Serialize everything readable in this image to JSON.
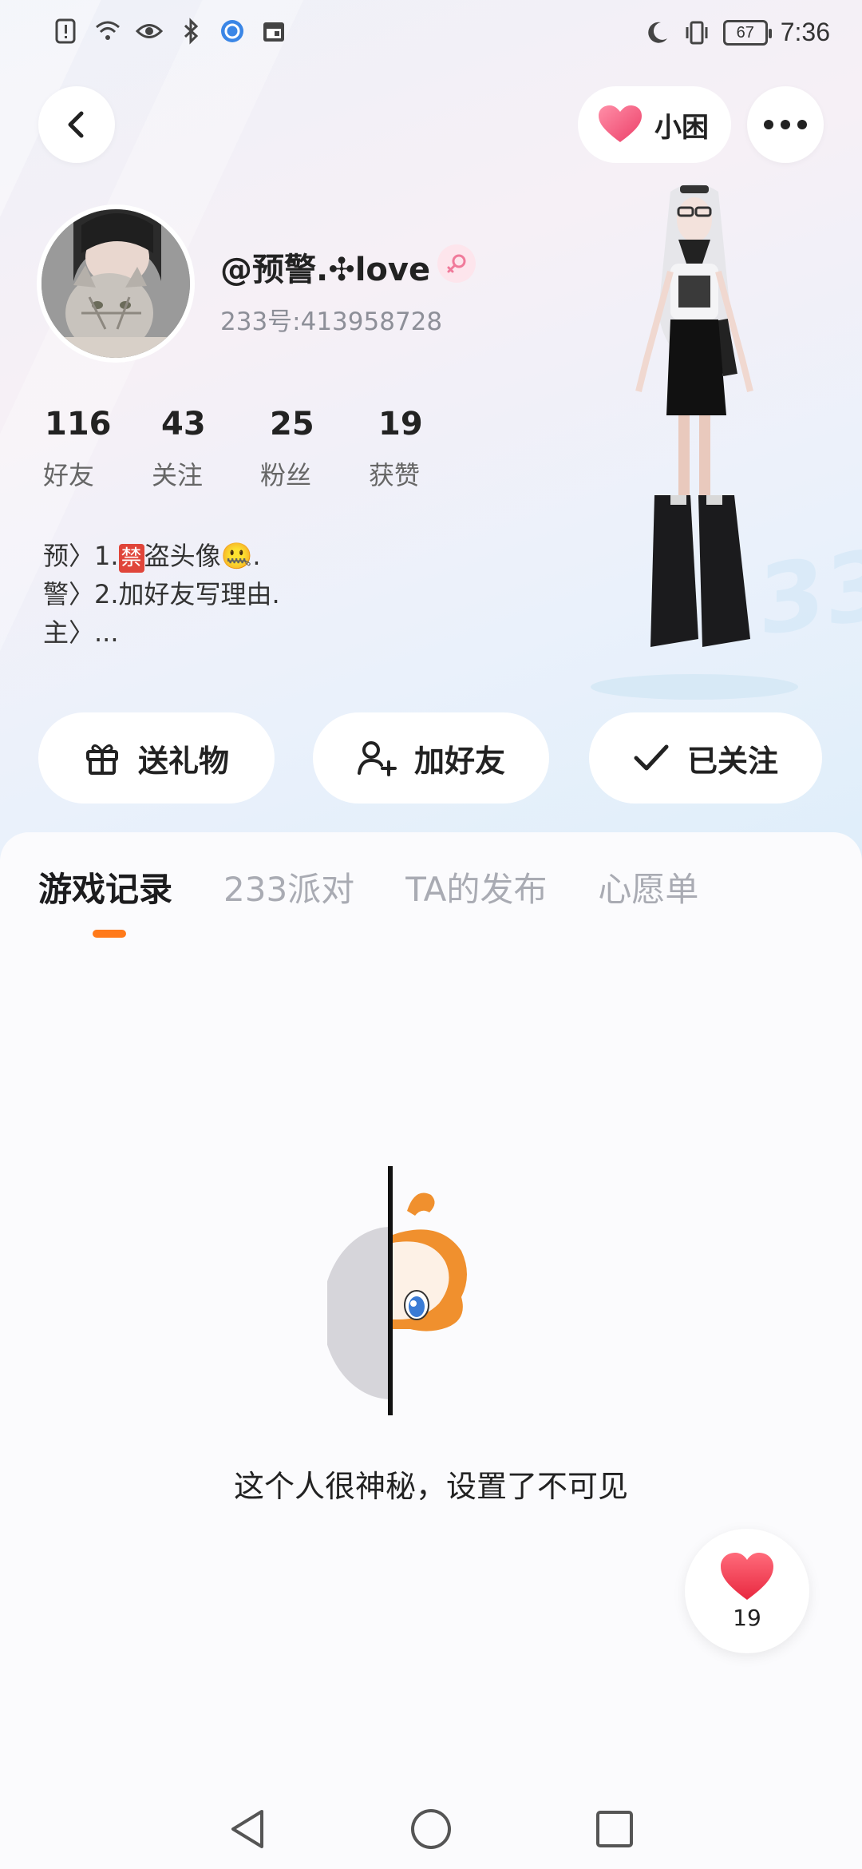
{
  "status_bar": {
    "time": "7:36",
    "battery": "67",
    "icons": [
      "notification-icon",
      "wifi-icon",
      "eye-icon",
      "bluetooth-icon",
      "app-icon",
      "calendar-icon",
      "moon-icon",
      "vibrate-icon"
    ]
  },
  "header": {
    "back_icon": "chevron-left-icon",
    "mood_label": "小困",
    "more_icon": "more-icon"
  },
  "profile": {
    "username": "@预警.✣love",
    "uid": "233号:413958728",
    "gender": "female"
  },
  "stats": [
    {
      "value": "116",
      "label": "好友"
    },
    {
      "value": "43",
      "label": "关注"
    },
    {
      "value": "25",
      "label": "粉丝"
    },
    {
      "value": "19",
      "label": "获赞"
    }
  ],
  "bio": {
    "line1_prefix": "预〉1.",
    "line1_tag": "禁",
    "line1_suffix": "盗头像🤐.",
    "line2": "警〉2.加好友写理由.",
    "line3": "主〉..."
  },
  "actions": {
    "gift": "送礼物",
    "add_friend": "加好友",
    "following": "已关注"
  },
  "tabs": [
    "游戏记录",
    "233派对",
    "TA的发布",
    "心愿单"
  ],
  "active_tab": "游戏记录",
  "empty_state": {
    "message": "这个人很神秘，设置了不可见"
  },
  "like_button": {
    "count": "19"
  },
  "colors": {
    "accent": "#ff7a1a",
    "heart": "#f0506e",
    "ban_tag": "#e0453a"
  }
}
